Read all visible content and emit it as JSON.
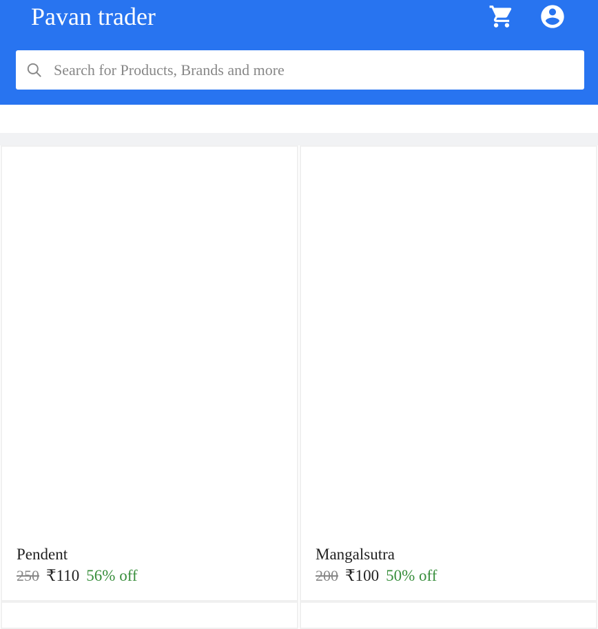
{
  "header": {
    "brand": "Pavan trader",
    "cart_icon": "cart-icon",
    "account_icon": "account-circle-icon",
    "background": "#2874f0"
  },
  "search": {
    "placeholder": "Search for Products, Brands and more",
    "value": "",
    "icon": "search-icon"
  },
  "products": [
    {
      "name": "Pendent",
      "mrp": "250",
      "price": "₹110",
      "discount": "56% off"
    },
    {
      "name": "Mangalsutra",
      "mrp": "200",
      "price": "₹100",
      "discount": "50% off"
    }
  ],
  "colors": {
    "discount": "#388e3c",
    "mrp": "#878787"
  }
}
